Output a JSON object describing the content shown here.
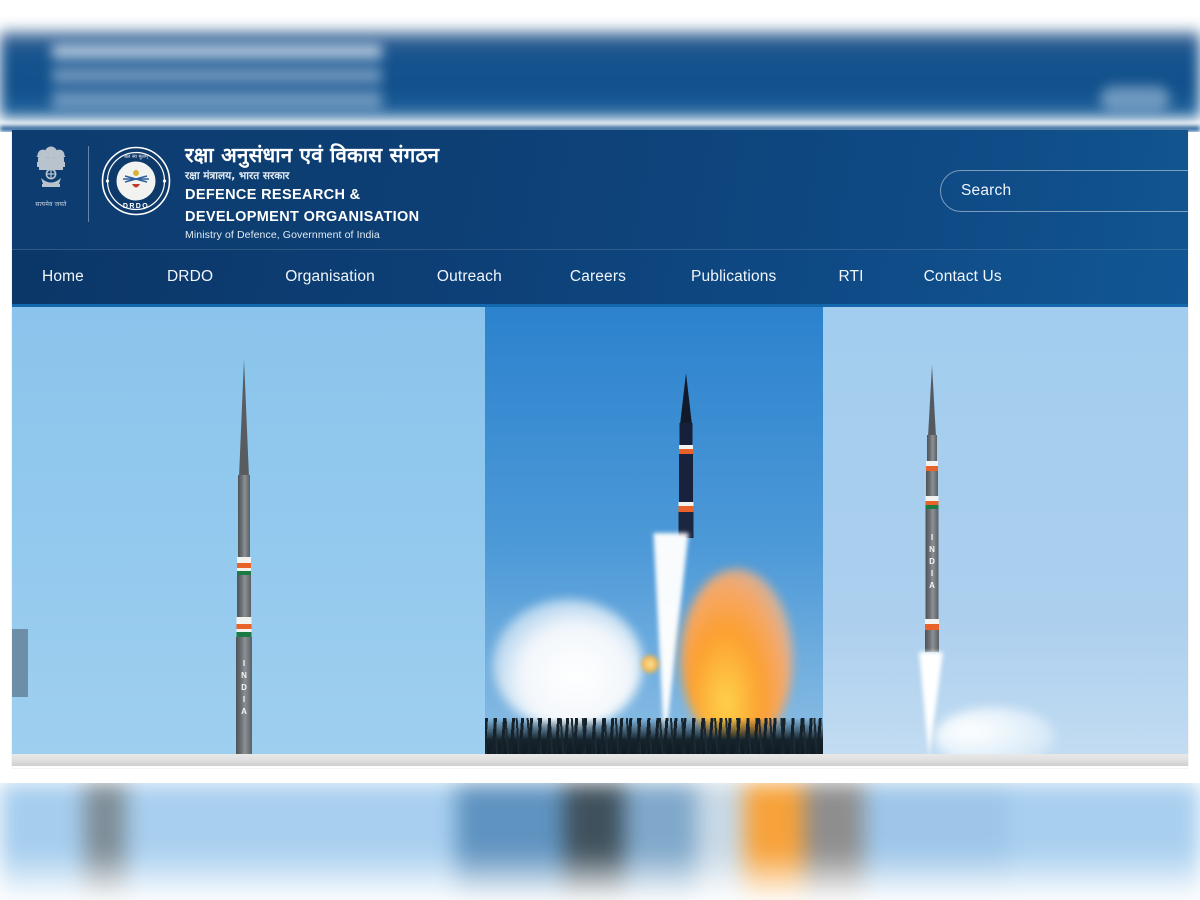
{
  "site": {
    "emblem_alt": "state-emblem-of-india",
    "emblem_motto": "सत्यमेव जयते",
    "seal_text": "DRDO",
    "title_hindi": "रक्षा अनुसंधान एवं विकास संगठन",
    "subtitle_hindi": "रक्षा मंत्रालय, भारत सरकार",
    "title_en_line1": "DEFENCE RESEARCH &",
    "title_en_line2": "DEVELOPMENT ORGANISATION",
    "subtitle_en": "Ministry of Defence, Government of India"
  },
  "search": {
    "placeholder": "Search",
    "value": ""
  },
  "nav": {
    "items": [
      {
        "label": "Home"
      },
      {
        "label": "DRDO"
      },
      {
        "label": "Organisation"
      },
      {
        "label": "Outreach"
      },
      {
        "label": "Careers"
      },
      {
        "label": "Publications"
      },
      {
        "label": "RTI"
      },
      {
        "label": "Contact Us"
      }
    ]
  },
  "carousel": {
    "prev_label": "",
    "slides": [
      {
        "name": "agni-missile-vertical",
        "caption": "",
        "marking": "INDIA"
      },
      {
        "name": "missile-launch-plume",
        "caption": "",
        "marking": ""
      },
      {
        "name": "missile-ascent",
        "caption": "",
        "marking": "INDIA"
      }
    ]
  },
  "colors": {
    "header_navy": "#0d3c70",
    "nav_blue": "#0d4077",
    "nav_accent": "#1368ad",
    "sky_light": "#8cc5ec",
    "sky_mid": "#2f86cf",
    "flame_orange": "#f7a23a",
    "tricolor_saffron": "#e8622a",
    "tricolor_green": "#1d7a45",
    "prev_button": "#6d8ea8"
  }
}
